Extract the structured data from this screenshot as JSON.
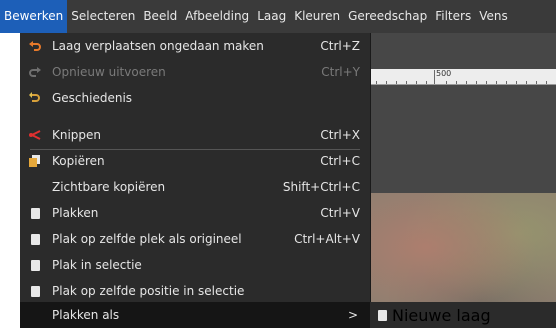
{
  "menubar": {
    "items": [
      "Bewerken",
      "Selecteren",
      "Beeld",
      "Afbeelding",
      "Laag",
      "Kleuren",
      "Gereedschap",
      "Filters",
      "Vens"
    ]
  },
  "ruler": {
    "label": "500"
  },
  "menu": {
    "items": [
      {
        "label": "Laag verplaatsen ongedaan maken",
        "shortcut": "Ctrl+Z",
        "icon": "undo-icon",
        "disabled": false
      },
      {
        "label": "Opnieuw uitvoeren",
        "shortcut": "Ctrl+Y",
        "icon": "redo-icon",
        "disabled": true
      },
      {
        "label": "Geschiedenis",
        "shortcut": "",
        "icon": "history-icon",
        "disabled": false
      },
      {
        "label": "Knippen",
        "shortcut": "Ctrl+X",
        "icon": "scissors-icon",
        "disabled": false
      },
      {
        "label": "Kopiëren",
        "shortcut": "Ctrl+C",
        "icon": "copy-icon",
        "disabled": false
      },
      {
        "label": "Zichtbare kopiëren",
        "shortcut": "Shift+Ctrl+C",
        "icon": "",
        "disabled": false
      },
      {
        "label": "Plakken",
        "shortcut": "Ctrl+V",
        "icon": "paste-icon",
        "disabled": false
      },
      {
        "label": "Plak op zelfde plek als origineel",
        "shortcut": "Ctrl+Alt+V",
        "icon": "paste-icon",
        "disabled": false
      },
      {
        "label": "Plak in selectie",
        "shortcut": "",
        "icon": "paste-icon",
        "disabled": false
      },
      {
        "label": "Plak op zelfde positie in selectie",
        "shortcut": "",
        "icon": "paste-icon",
        "disabled": false
      },
      {
        "label": "Plakken als",
        "shortcut": "",
        "icon": "",
        "disabled": false,
        "submenu": true
      }
    ],
    "submenu_arrow": ">"
  },
  "submenu": {
    "items": [
      {
        "label": "Nieuwe laag",
        "icon": "new-layer-icon"
      }
    ]
  },
  "colors": {
    "menubar_bg": "#3a3a3a",
    "menu_bg": "#2b2b2b",
    "highlight": "#1d5fb8",
    "undo_icon": "#e87a2a",
    "cut_icon": "#e03030"
  }
}
